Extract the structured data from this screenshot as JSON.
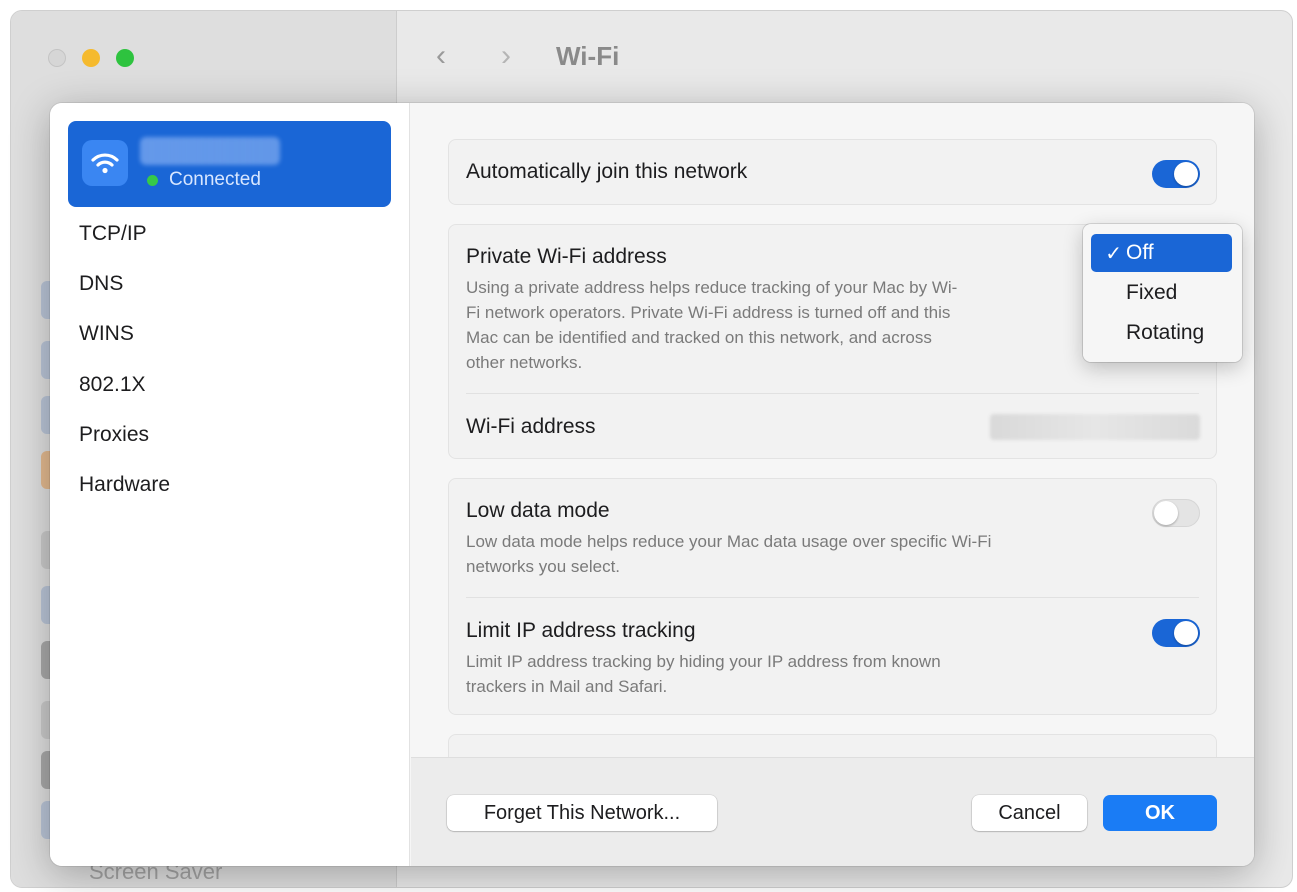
{
  "window": {
    "title": "Wi-Fi",
    "back_glyph": "‹",
    "forward_glyph": "›",
    "partial_sidebar_label": "Screen Saver"
  },
  "network": {
    "status": "Connected",
    "icon": "wifi-icon"
  },
  "sidebar": {
    "items": [
      {
        "label": "TCP/IP"
      },
      {
        "label": "DNS"
      },
      {
        "label": "WINS"
      },
      {
        "label": "802.1X"
      },
      {
        "label": "Proxies"
      },
      {
        "label": "Hardware"
      }
    ]
  },
  "settings": {
    "auto_join": {
      "label": "Automatically join this network",
      "enabled": true
    },
    "private_address": {
      "label": "Private Wi-Fi address",
      "description": "Using a private address helps reduce tracking of your Mac by Wi-Fi network operators. Private Wi-Fi address is turned off and this Mac can be identified and tracked on this network, and across other networks.",
      "description_lines": [
        "Using a private address helps reduce tracking of your Mac by Wi-",
        "Fi network operators. Private Wi-Fi address is turned off and this",
        "Mac can be identified and tracked on this network, and across",
        "other networks."
      ],
      "selected": "Off",
      "options": [
        {
          "label": "Off",
          "checked": true
        },
        {
          "label": "Fixed",
          "checked": false
        },
        {
          "label": "Rotating",
          "checked": false
        }
      ],
      "check_glyph": "✓"
    },
    "wifi_address": {
      "label": "Wi-Fi address"
    },
    "low_data_mode": {
      "label": "Low data mode",
      "description_lines": [
        "Low data mode helps reduce your Mac data usage over specific Wi-Fi",
        "networks you select."
      ],
      "enabled": false
    },
    "limit_ip_tracking": {
      "label": "Limit IP address tracking",
      "description_lines": [
        "Limit IP address tracking by hiding your IP address from known",
        "trackers in Mail and Safari."
      ],
      "enabled": true
    }
  },
  "footer": {
    "forget_label": "Forget This Network...",
    "cancel_label": "Cancel",
    "ok_label": "OK"
  },
  "colors": {
    "accent": "#1a66d6",
    "ok_button": "#1a7cf5",
    "connected_dot": "#36c94a",
    "traffic_min": "#f5ba2e",
    "traffic_max": "#2ec33f"
  }
}
